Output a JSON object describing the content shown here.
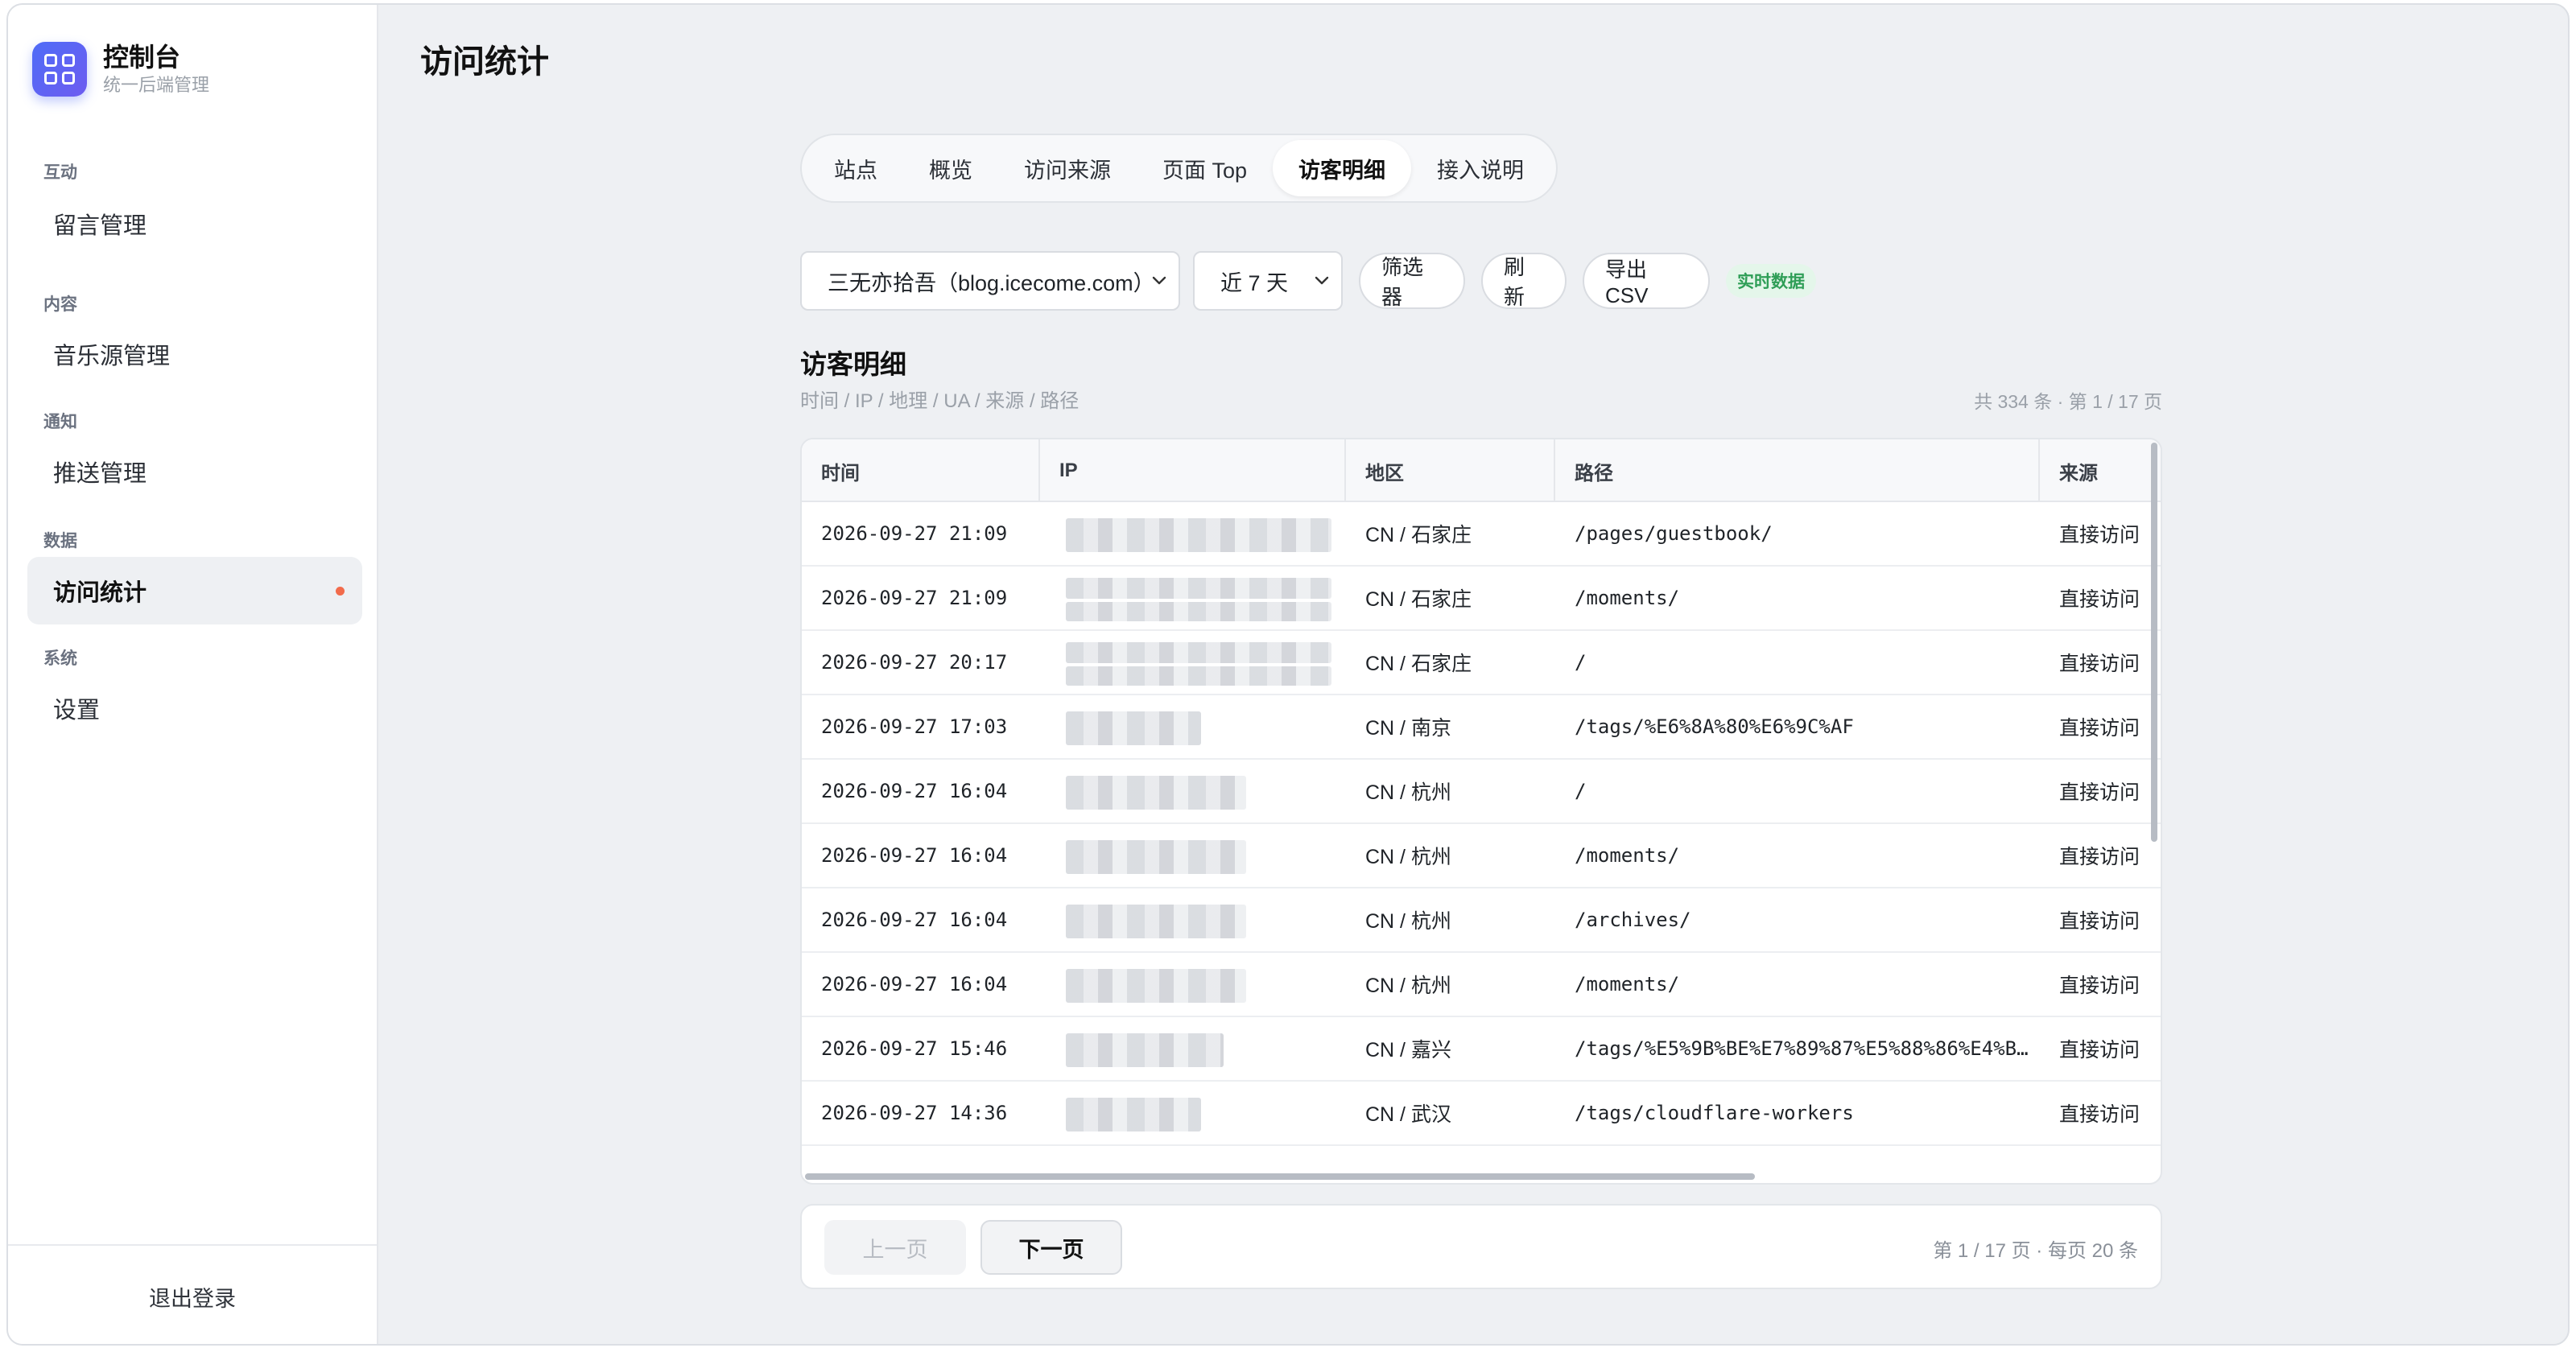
{
  "sidebar": {
    "brand_title": "控制台",
    "brand_subtitle": "统一后端管理",
    "groups": [
      {
        "label": "互动",
        "items": [
          {
            "label": "留言管理"
          }
        ]
      },
      {
        "label": "内容",
        "items": [
          {
            "label": "音乐源管理"
          }
        ]
      },
      {
        "label": "通知",
        "items": [
          {
            "label": "推送管理"
          }
        ]
      },
      {
        "label": "数据",
        "items": [
          {
            "label": "访问统计",
            "active": true
          }
        ]
      },
      {
        "label": "系统",
        "items": [
          {
            "label": "设置"
          }
        ]
      }
    ],
    "logout_label": "退出登录"
  },
  "page_title": "访问统计",
  "tabs": [
    {
      "label": "站点"
    },
    {
      "label": "概览"
    },
    {
      "label": "访问来源"
    },
    {
      "label": "页面 Top"
    },
    {
      "label": "访客明细",
      "active": true
    },
    {
      "label": "接入说明"
    }
  ],
  "toolbar": {
    "site_select": "三无亦拾吾（blog.icecome.com）",
    "range_select": "近 7 天",
    "filter_label": "筛选器",
    "refresh_label": "刷新",
    "export_label": "导出 CSV",
    "live_badge": "实时数据"
  },
  "section": {
    "title": "访客明细",
    "subtitle": "时间 / IP / 地理 / UA / 来源 / 路径",
    "meta": "共 334 条 · 第 1 / 17 页"
  },
  "table": {
    "headers": [
      "时间",
      "IP",
      "地区",
      "路径",
      "来源"
    ],
    "rows": [
      {
        "time": "2026-09-27 21:09",
        "region": "CN / 石家庄",
        "path": "/pages/guestbook/",
        "source": "直接访问"
      },
      {
        "time": "2026-09-27 21:09",
        "region": "CN / 石家庄",
        "path": "/moments/",
        "source": "直接访问"
      },
      {
        "time": "2026-09-27 20:17",
        "region": "CN / 石家庄",
        "path": "/",
        "source": "直接访问"
      },
      {
        "time": "2026-09-27 17:03",
        "region": "CN / 南京",
        "path": "/tags/%E6%8A%80%E6%9C%AF",
        "source": "直接访问"
      },
      {
        "time": "2026-09-27 16:04",
        "region": "CN / 杭州",
        "path": "/",
        "source": "直接访问"
      },
      {
        "time": "2026-09-27 16:04",
        "region": "CN / 杭州",
        "path": "/moments/",
        "source": "直接访问"
      },
      {
        "time": "2026-09-27 16:04",
        "region": "CN / 杭州",
        "path": "/archives/",
        "source": "直接访问"
      },
      {
        "time": "2026-09-27 16:04",
        "region": "CN / 杭州",
        "path": "/moments/",
        "source": "直接访问"
      },
      {
        "time": "2026-09-27 15:46",
        "region": "CN / 嘉兴",
        "path": "/tags/%E5%9B%BE%E7%89%87%E5%88%86%E4%B…",
        "source": "直接访问"
      },
      {
        "time": "2026-09-27 14:36",
        "region": "CN / 武汉",
        "path": "/tags/cloudflare-workers",
        "source": "直接访问"
      }
    ]
  },
  "pager": {
    "prev_label": "上一页",
    "next_label": "下一页",
    "info": "第 1 / 17 页 · 每页 20 条"
  }
}
